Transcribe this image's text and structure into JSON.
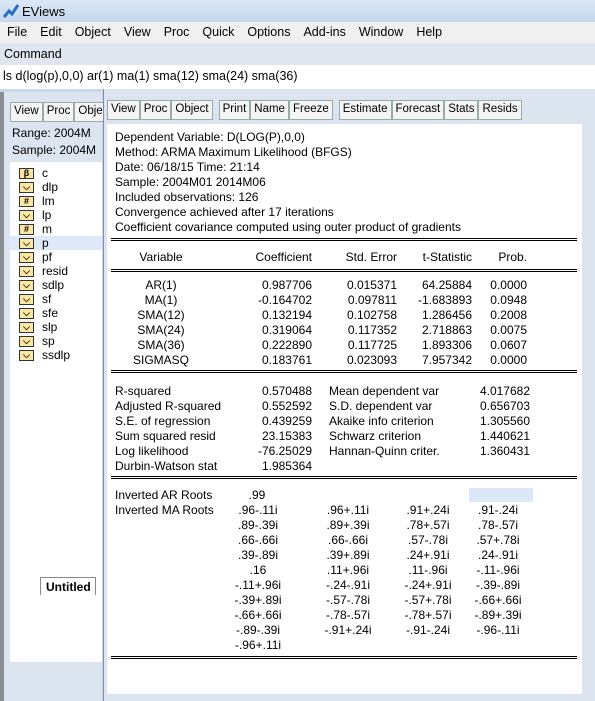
{
  "app": {
    "title": "EViews",
    "menu": [
      "File",
      "Edit",
      "Object",
      "View",
      "Proc",
      "Quick",
      "Options",
      "Add-ins",
      "Window",
      "Help"
    ],
    "command_label": "Command",
    "command_text": "ls d(log(p),0,0)  ar(1)  ma(1)  sma(12) sma(24) sma(36)"
  },
  "workfile": {
    "toolbar": [
      "View",
      "Proc",
      "Obje"
    ],
    "range": "Range:  2004M",
    "sample": "Sample: 2004M",
    "items": [
      {
        "name": "c",
        "icon": "coef-icon"
      },
      {
        "name": "dlp",
        "icon": "series-icon"
      },
      {
        "name": "lm",
        "icon": "equation-icon"
      },
      {
        "name": "lp",
        "icon": "series-icon"
      },
      {
        "name": "m",
        "icon": "equation-icon"
      },
      {
        "name": "p",
        "icon": "series-icon",
        "selected": true
      },
      {
        "name": "pf",
        "icon": "series-icon"
      },
      {
        "name": "resid",
        "icon": "series-icon"
      },
      {
        "name": "sdlp",
        "icon": "series-icon"
      },
      {
        "name": "sf",
        "icon": "series-icon"
      },
      {
        "name": "sfe",
        "icon": "series-icon"
      },
      {
        "name": "slp",
        "icon": "series-icon"
      },
      {
        "name": "sp",
        "icon": "series-icon"
      },
      {
        "name": "ssdlp",
        "icon": "series-icon"
      }
    ],
    "tab": "Untitled"
  },
  "equation": {
    "toolbar": [
      [
        "View",
        "Proc",
        "Object"
      ],
      [
        "Print",
        "Name",
        "Freeze"
      ],
      [
        "Estimate",
        "Forecast",
        "Stats",
        "Resids"
      ]
    ],
    "header": [
      "Dependent Variable: D(LOG(P),0,0)",
      "Method: ARMA Maximum Likelihood (BFGS)",
      "Date: 06/18/15   Time: 21:14",
      "Sample: 2004M01 2014M06",
      "Included observations: 126",
      "Convergence achieved after 17 iterations",
      "Coefficient covariance computed using outer product of gradients"
    ],
    "columns": [
      "Variable",
      "Coefficient",
      "Std. Error",
      "t-Statistic",
      "Prob."
    ],
    "rows": [
      [
        "AR(1)",
        "0.987706",
        "0.015371",
        "64.25884",
        "0.0000"
      ],
      [
        "MA(1)",
        "-0.164702",
        "0.097811",
        "-1.683893",
        "0.0948"
      ],
      [
        "SMA(12)",
        "0.132194",
        "0.102758",
        "1.286456",
        "0.2008"
      ],
      [
        "SMA(24)",
        "0.319064",
        "0.117352",
        "2.718863",
        "0.0075"
      ],
      [
        "SMA(36)",
        "0.222890",
        "0.117725",
        "1.893306",
        "0.0607"
      ],
      [
        "SIGMASQ",
        "0.183761",
        "0.023093",
        "7.957342",
        "0.0000"
      ]
    ],
    "stats": [
      [
        "R-squared",
        "0.570488",
        "Mean dependent var",
        "4.017682"
      ],
      [
        "Adjusted R-squared",
        "0.552592",
        "S.D. dependent var",
        "0.656703"
      ],
      [
        "S.E. of regression",
        "0.439259",
        "Akaike info criterion",
        "1.305560"
      ],
      [
        "Sum squared resid",
        "23.15383",
        "Schwarz criterion",
        "1.440621"
      ],
      [
        "Log likelihood",
        "-76.25029",
        "Hannan-Quinn criter.",
        "1.360431"
      ],
      [
        "Durbin-Watson stat",
        "1.985364",
        "",
        ""
      ]
    ],
    "ar_label": "Inverted AR Roots",
    "ar_roots": [
      ".99"
    ],
    "ma_label": "Inverted MA Roots",
    "ma_roots": [
      [
        ".96-.11i",
        ".96+.11i",
        ".91+.24i",
        ".91-.24i"
      ],
      [
        ".89-.39i",
        ".89+.39i",
        ".78+.57i",
        ".78-.57i"
      ],
      [
        ".66-.66i",
        ".66-.66i",
        ".57-.78i",
        ".57+.78i"
      ],
      [
        ".39-.89i",
        ".39+.89i",
        ".24+.91i",
        ".24-.91i"
      ],
      [
        ".16",
        ".11+.96i",
        ".11-.96i",
        "-.11-.96i"
      ],
      [
        "-.11+.96i",
        "-.24-.91i",
        "-.24+.91i",
        "-.39-.89i"
      ],
      [
        "-.39+.89i",
        "-.57-.78i",
        "-.57+.78i",
        "-.66+.66i"
      ],
      [
        "-.66+.66i",
        "-.78-.57i",
        "-.78+.57i",
        "-.89+.39i"
      ],
      [
        "-.89-.39i",
        "-.91+.24i",
        "-.91-.24i",
        "-.96-.11i"
      ],
      [
        "-.96+.11i"
      ]
    ]
  }
}
